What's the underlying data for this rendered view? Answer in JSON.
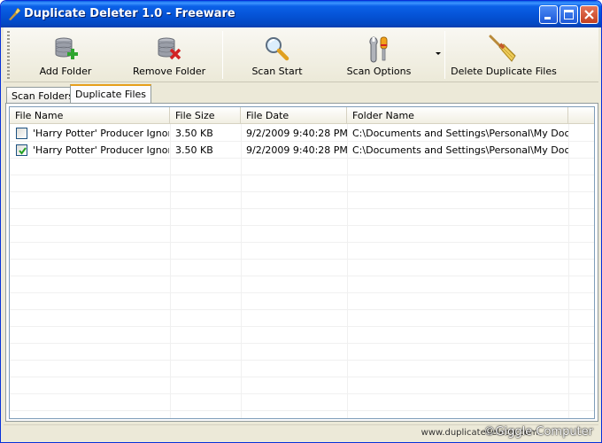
{
  "window": {
    "title": "Duplicate Deleter 1.0 - Freeware"
  },
  "toolbar": {
    "buttons": [
      {
        "label": "Add Folder",
        "icon": "add-folder-icon"
      },
      {
        "label": "Remove Folder",
        "icon": "remove-folder-icon"
      },
      {
        "label": "Scan Start",
        "icon": "magnifier-icon"
      },
      {
        "label": "Scan Options",
        "icon": "tools-icon"
      },
      {
        "label": "Delete Duplicate Files",
        "icon": "broom-icon"
      }
    ]
  },
  "tabs": [
    {
      "label": "Scan Folders",
      "active": false
    },
    {
      "label": "Duplicate Files",
      "active": true
    }
  ],
  "table": {
    "columns": [
      "File Name",
      "File Size",
      "File Date",
      "Folder Name"
    ],
    "rows": [
      {
        "checked": false,
        "file_name": "'Harry Potter' Producer Ignor...",
        "file_size": "3.50 KB",
        "file_date": "9/2/2009 9:40:28 PM",
        "folder_name": "C:\\Documents and Settings\\Personal\\My Docu..."
      },
      {
        "checked": true,
        "file_name": "'Harry Potter' Producer Ignor...",
        "file_size": "3.50 KB",
        "file_date": "9/2/2009 9:40:28 PM",
        "folder_name": "C:\\Documents and Settings\\Personal\\My Docu..."
      }
    ]
  },
  "status": {
    "url": "www.duplicatedeleter.com",
    "watermark": "©Giggle Computer"
  },
  "colors": {
    "titlebar": "#0553d6",
    "tab_accent": "#e69f1c",
    "checkmark": "#21a121"
  }
}
